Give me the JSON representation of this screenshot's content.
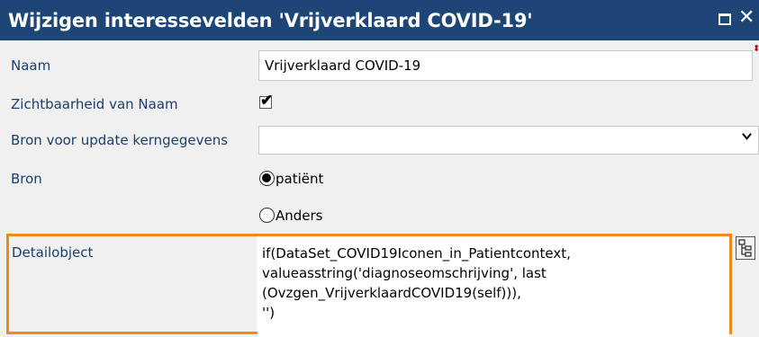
{
  "window": {
    "title": "Wijzigen interessevelden 'Vrijverklaard COVID-19'",
    "restore_icon": "restore-icon",
    "close_glyph": "✕"
  },
  "form": {
    "naam_label": "Naam",
    "naam_value": "Vrijverklaard COVID-19",
    "zichtbaarheid_label": "Zichtbaarheid van Naam",
    "zichtbaarheid_checked": true,
    "bron_update_label": "Bron voor update kerngegevens",
    "bron_update_value": "",
    "bron_label": "Bron",
    "bron_options": [
      {
        "label": "patiënt",
        "checked": true
      },
      {
        "label": "Anders",
        "checked": false
      }
    ],
    "detailobject_label": "Detailobject",
    "detailobject_lines": [
      "if(DataSet_COVID19Iconen_in_Patientcontext,",
      "valueasstring('diagnoseomschrijving', last",
      "(Ovzgen_VrijverklaardCOVID19(self))),",
      "'')"
    ]
  },
  "colors": {
    "titlebar": "#1d4676",
    "highlight": "#f08a18",
    "label": "#1b3f6b"
  }
}
